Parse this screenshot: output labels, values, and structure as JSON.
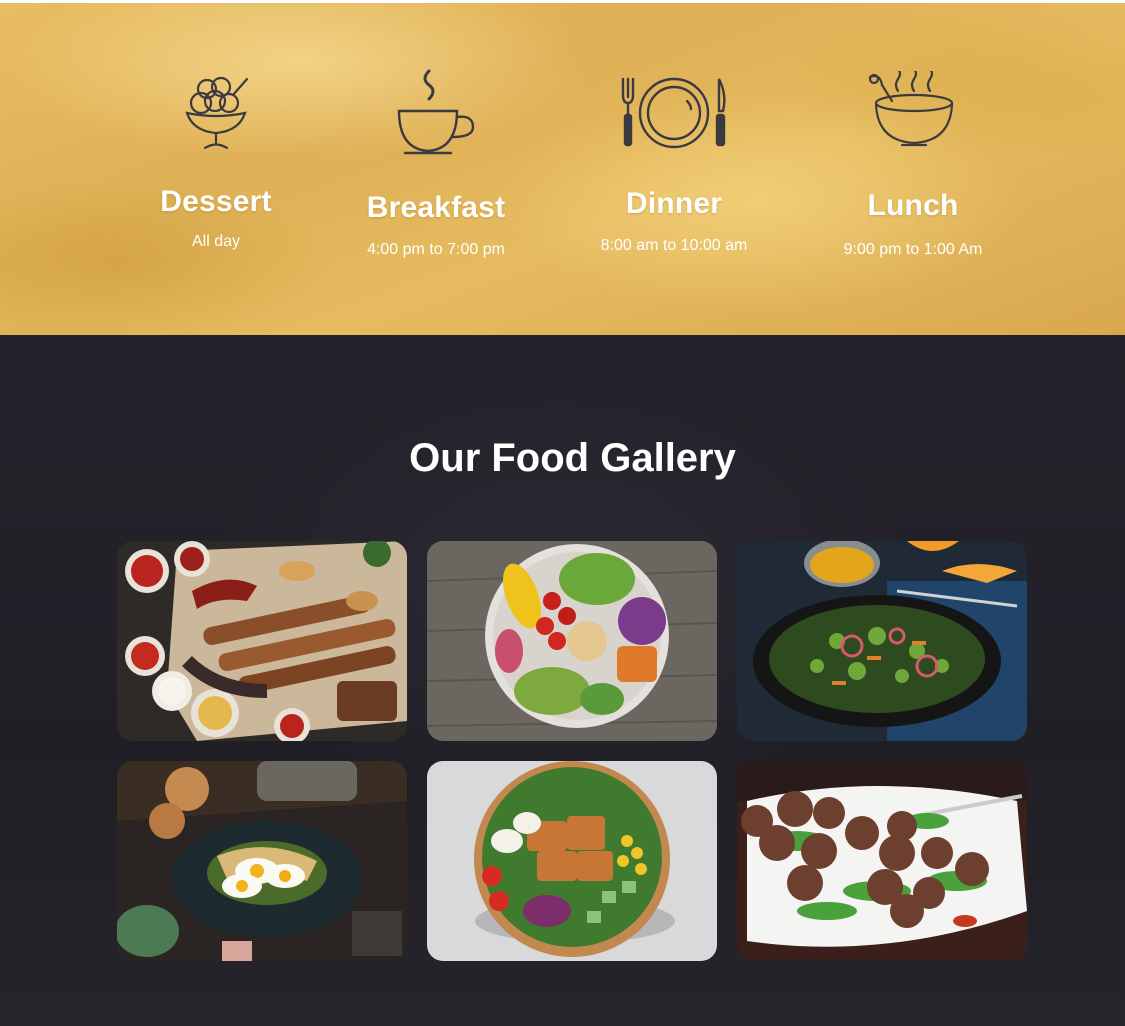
{
  "meals": [
    {
      "title": "Dessert",
      "time": "All day",
      "icon": "ice-cream-icon"
    },
    {
      "title": "Breakfast",
      "time": "4:00 pm to 7:00 pm",
      "icon": "coffee-cup-icon"
    },
    {
      "title": "Dinner",
      "time": "8:00 am to 10:00 am",
      "icon": "plate-cutlery-icon"
    },
    {
      "title": "Lunch",
      "time": "9:00 pm to 1:00 Am",
      "icon": "soup-bowl-icon"
    }
  ],
  "gallery": {
    "title": "Our Food Gallery",
    "images": [
      "grilled-kebab-platter",
      "vegetable-salad-bowl",
      "dark-plate-salad",
      "egg-avocado-plate",
      "tofu-salad-bowl",
      "meatballs-greens-plate"
    ]
  },
  "colors": {
    "hero": "#e2b45a",
    "gallery_bg": "#222129",
    "icon_stroke": "#3b3a40"
  }
}
